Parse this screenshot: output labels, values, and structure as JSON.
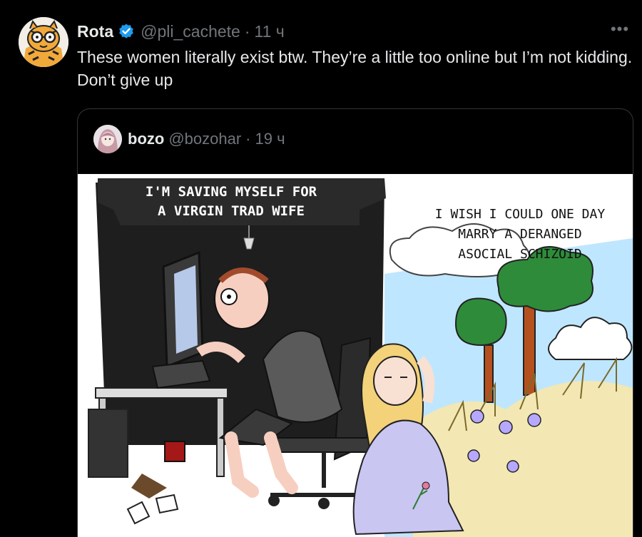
{
  "tweet": {
    "author_name": "Rota",
    "handle": "@pli_cachete",
    "separator": "·",
    "time": "11 ч",
    "more": "•••",
    "text": "These women literally exist btw. They’re a little too online but I’m not kidding. Don’t give up"
  },
  "quoted": {
    "author_name": "bozo",
    "handle": "@bozohar",
    "separator": "·",
    "time": "19 ч"
  },
  "comic": {
    "left_caption_line1": "I'M SAVING MYSELF FOR",
    "left_caption_line2": "A VIRGIN TRAD WIFE",
    "right_caption_line1": "I WISH I COULD ONE DAY",
    "right_caption_line2": "MARRY A DERANGED",
    "right_caption_line3": "ASOCIAL SCHIZOID"
  },
  "colors": {
    "background": "#000000",
    "text": "#e7e9ea",
    "secondary": "#71767b",
    "verified": "#1d9bf0",
    "sky": "#bfe6ff"
  },
  "icons": {
    "verified": "verified-badge-icon",
    "more": "more-options-icon"
  }
}
